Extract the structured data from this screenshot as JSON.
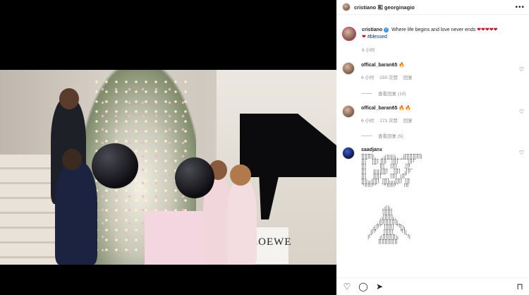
{
  "post": {
    "header": {
      "users": "cristiano 和 georginagio",
      "more": "•••"
    },
    "caption": {
      "username": "cristiano",
      "verified": "✓",
      "text": "Where life begins and love never ends",
      "hearts": "❤❤❤❤❤",
      "heart2": "❤",
      "hashtag": "#blessed",
      "time": "6 小时"
    },
    "video": {
      "brand_text": "LOEWE"
    }
  },
  "comments": [
    {
      "username": "offical_baran65",
      "text": "🔥",
      "time": "6 小时",
      "likes": "250 次赞",
      "reply": "回复",
      "view_replies": "查看回复 (10)"
    },
    {
      "username": "offical_baran65",
      "text": "🔥🔥",
      "time": "6 小时",
      "likes": "171 次赞",
      "reply": "回复",
      "view_replies": "查看回复 (5)"
    },
    {
      "username": "saadjanx",
      "art1": "⣿⣿⣿⣷⡀ ⢀⣴⣶⣶⣦⡀⢀⣾⣿⣿⣿⣿⣷\n⣿⡏ ⢸⣿⡇⣿⣿⠉⢹⣿⡏⠉⠉⢹⣿⠏\n⣿⡇ ⠈⠉ ⣿⡇ ⢸⣿⡇  ⣸⡿\n⣿⡇  ⣶⣶⣾⣿⡇ ⢸⣿⡇ ⣼⡿⠁\n⣿⡇  ⣿⣿⡏⠉ ⢸⣿⡇⢰⣿⠃\n⣿⣷⣤⣾⣿⡇⢸⣿⣧⣤⣼⣿⡇⢸⣿\n⠙⠿⠿⠟⠋ ⠈⠛⠿⠿⠟⠁ ⠸⠿",
      "art2": "      ⢀⣴⣦⡀\n      ⢸⣿⣿⡇\n     ⢀⣼⣿⣿⣧⡀\n    ⢀⣾⣿⣿⣿⣿⣷⡀\n   ⣴⡿⠋⢸⣿⣿⡇⠙⢿⣦\n  ⣾⠟  ⢸⣿⣿⡇  ⠻⣷\n ⡾⠁  ⣴⣿⣿⣿⣿⣦  ⠈⢷\n     ⣿⣿⣿⣿⣿⣿"
    }
  ],
  "actions": {
    "like_icon": "♡",
    "comment_icon": "◯",
    "share_icon": "➤",
    "save_icon": "⊓"
  }
}
